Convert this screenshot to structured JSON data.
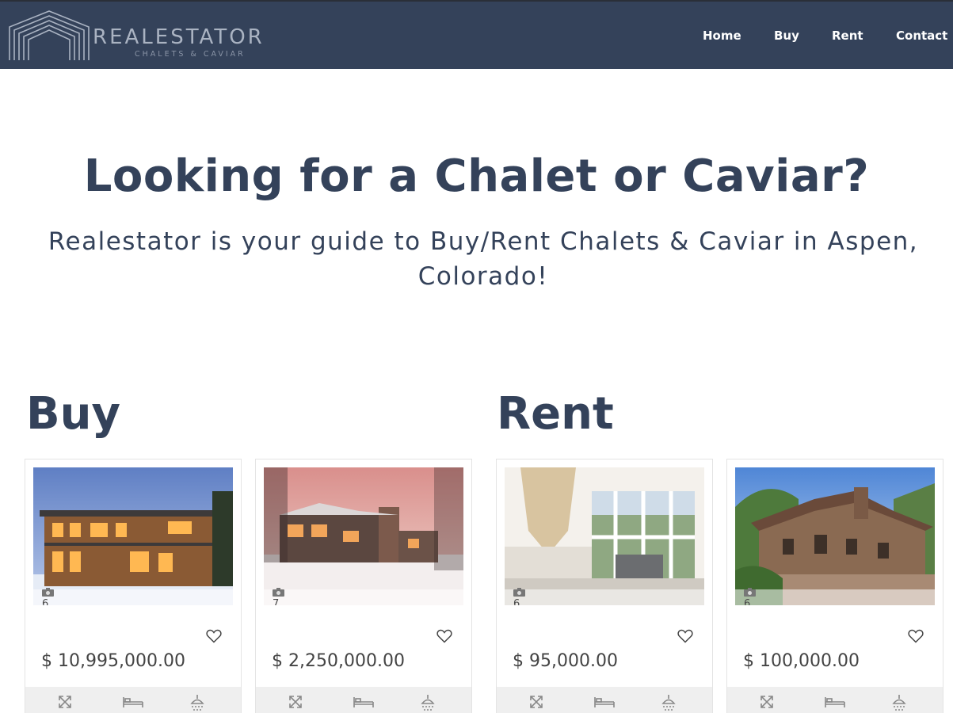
{
  "brand": {
    "name": "REALESTATOR",
    "tagline": "CHALETS & CAVIAR"
  },
  "nav": {
    "home": "Home",
    "buy": "Buy",
    "rent": "Rent",
    "contact": "Contact"
  },
  "hero": {
    "title": "Looking for a Chalet or Caviar?",
    "subtitle": "Realestator is your guide to Buy/Rent Chalets & Caviar in Aspen, Colorado!"
  },
  "sections": {
    "buy": "Buy",
    "rent": "Rent"
  },
  "listings": [
    {
      "photo_count": "6",
      "price": "$ 10,995,000.00",
      "icons": [
        "area-icon",
        "bed-icon",
        "shower-icon"
      ]
    },
    {
      "photo_count": "7",
      "price": "$ 2,250,000.00",
      "icons": [
        "area-icon",
        "bed-icon",
        "shower-icon"
      ]
    },
    {
      "photo_count": "6",
      "price": "$ 95,000.00",
      "icons": [
        "area-icon",
        "bed-icon",
        "shower-icon"
      ]
    },
    {
      "photo_count": "6",
      "price": "$ 100,000.00",
      "icons": [
        "area-icon",
        "bed-icon",
        "shower-icon"
      ]
    }
  ],
  "colors": {
    "navbar": "#34425a",
    "heading": "#34425a",
    "footer_bg": "#efefef"
  }
}
